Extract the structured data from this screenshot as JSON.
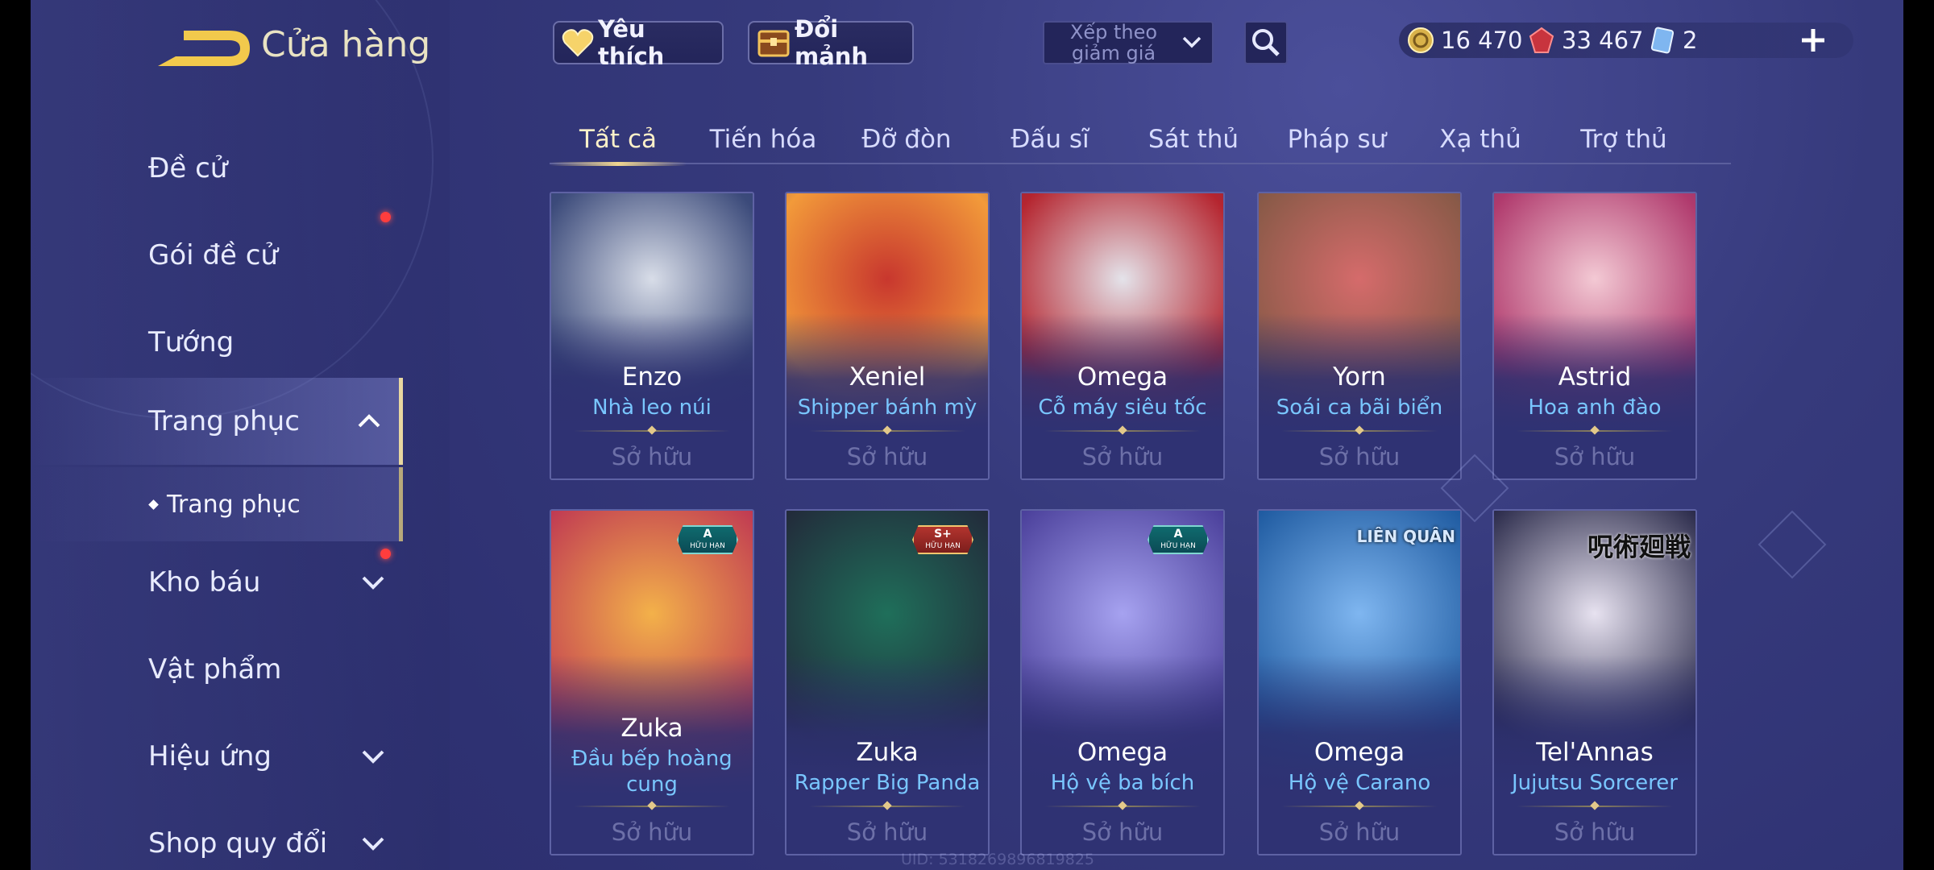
{
  "header": {
    "title": "Cửa hàng",
    "favorites_label": "Yêu thích",
    "shard_exchange_label": "Đổi mảnh",
    "sort": {
      "value": "Xếp theo giảm giá"
    }
  },
  "currency": {
    "gold": "16 470",
    "ruby": "33 467",
    "tickets": "2"
  },
  "sidebar": {
    "items": [
      {
        "label": "Đề cử"
      },
      {
        "label": "Gói đề cử"
      },
      {
        "label": "Tướng"
      },
      {
        "label": "Trang phục"
      },
      {
        "label": "Kho báu"
      },
      {
        "label": "Vật phẩm"
      },
      {
        "label": "Hiệu ứng"
      },
      {
        "label": "Shop quy đổi"
      }
    ],
    "sub_item": "Trang phục"
  },
  "tabs": [
    "Tất cả",
    "Tiến hóa",
    "Đỡ đòn",
    "Đấu sĩ",
    "Sát thủ",
    "Pháp sư",
    "Xạ thủ",
    "Trợ thủ"
  ],
  "cards": [
    {
      "hero": "Enzo",
      "skin": "Nhà leo núi",
      "status": "Sở hữu",
      "colors": [
        "#d8dde8",
        "#3b4a7a"
      ]
    },
    {
      "hero": "Xeniel",
      "skin": "Shipper bánh mỳ",
      "status": "Sở hữu",
      "colors": [
        "#c8372e",
        "#f29a3a"
      ]
    },
    {
      "hero": "Omega",
      "skin": "Cỗ máy siêu tốc",
      "status": "Sở hữu",
      "colors": [
        "#e4e3ea",
        "#b5252f"
      ]
    },
    {
      "hero": "Yorn",
      "skin": "Soái ca bãi biển",
      "status": "Sở hữu",
      "colors": [
        "#d56b6b",
        "#8a5a48"
      ]
    },
    {
      "hero": "Astrid",
      "skin": "Hoa anh đào",
      "status": "Sở hữu",
      "colors": [
        "#f3c9d4",
        "#b03a6d"
      ]
    },
    {
      "hero": "Zuka",
      "skin": "Đầu bếp hoàng cung",
      "status": "Sở hữu",
      "badge": "A",
      "badge_sub": "HỮU HẠN",
      "colors": [
        "#f3b14a",
        "#c03a52"
      ]
    },
    {
      "hero": "Zuka",
      "skin": "Rapper Big Panda",
      "status": "Sở hữu",
      "badge": "S+",
      "badge_sub": "HỮU HẠN",
      "colors": [
        "#1f6f5a",
        "#222a3a"
      ]
    },
    {
      "hero": "Omega",
      "skin": "Hộ vệ ba bích",
      "status": "Sở hữu",
      "badge": "A",
      "badge_sub": "HỮU HẠN",
      "colors": [
        "#a6a2f0",
        "#4a3f9a"
      ]
    },
    {
      "hero": "Omega",
      "skin": "Hộ vệ Carano",
      "status": "Sở hữu",
      "corner_text": "LIÊN QUÂN",
      "colors": [
        "#7fb6f0",
        "#1e5aa0"
      ]
    },
    {
      "hero": "Tel'Annas",
      "skin": "Jujutsu Sorcerer",
      "status": "Sở hữu",
      "corner_text": "呪術廻戦",
      "colors": [
        "#e7e2f0",
        "#2a2a4a"
      ]
    }
  ],
  "uid_text": "UID: 5318269896819825",
  "theme": {
    "accent_gold": "#f0d690",
    "skin_name": "#79c6ff",
    "notification": "#ff3d3d"
  }
}
